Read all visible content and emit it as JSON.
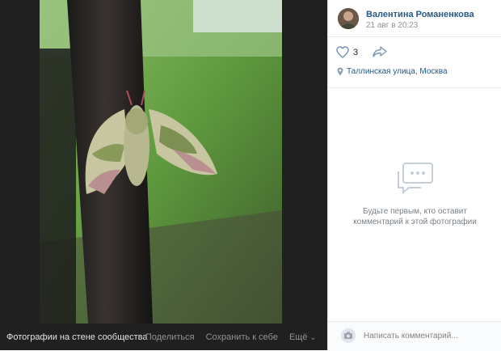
{
  "viewer": {
    "album_label": "Фотографии на стене сообщества",
    "actions": {
      "share": "Поделиться",
      "save": "Сохранить к себе",
      "more": "Ещё"
    }
  },
  "post": {
    "author": "Валентина Романенкова",
    "date": "21 авг в 20:23",
    "likes": "3",
    "place": "Таллинская улица, Москва"
  },
  "comments": {
    "empty_text": "Будьте первым, кто оставит комментарий к этой фотографии",
    "placeholder": "Написать комментарий..."
  },
  "icons": {
    "like": "heart-icon",
    "share": "share-arrow-icon",
    "place": "map-pin-icon",
    "empty": "comments-bubble-icon",
    "camera": "camera-icon",
    "more": "chevron-down-icon"
  },
  "colors": {
    "viewer_bg": "#202020",
    "link": "#2a5885",
    "muted": "#939393"
  }
}
